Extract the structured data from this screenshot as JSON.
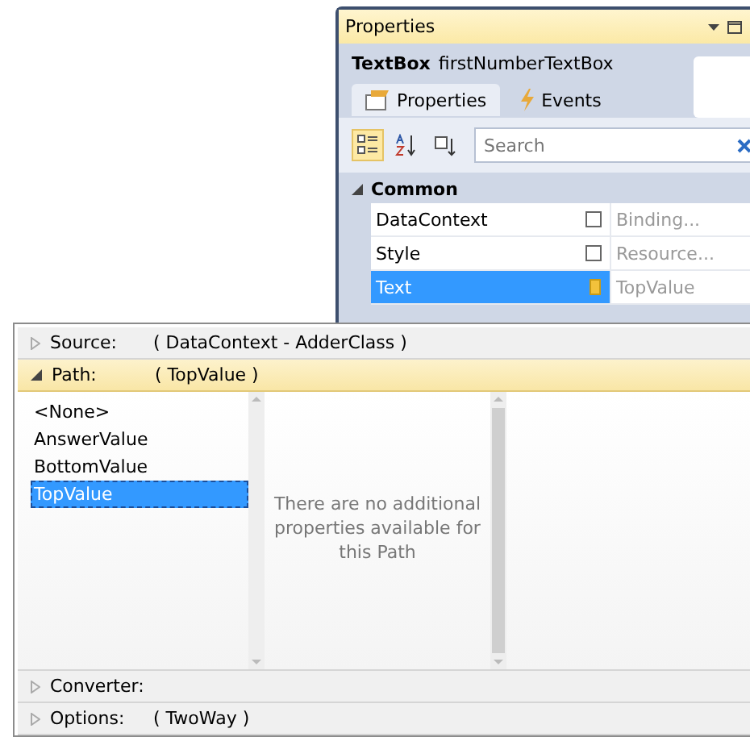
{
  "properties_panel": {
    "title": "Properties",
    "object": {
      "type": "TextBox",
      "name": "firstNumberTextBox"
    },
    "tabs": [
      {
        "label": "Properties",
        "kind": "properties",
        "selected": true
      },
      {
        "label": "Events",
        "kind": "events",
        "selected": false
      }
    ],
    "view_buttons": [
      {
        "kind": "categorized",
        "selected": true
      },
      {
        "kind": "alphabetical",
        "selected": false
      },
      {
        "kind": "filter",
        "selected": false
      }
    ],
    "search": {
      "placeholder": "Search"
    },
    "categories": [
      {
        "name": "Common",
        "expanded": true,
        "rows": [
          {
            "name": "DataContext",
            "value": "Binding...",
            "bound": false,
            "selected": false
          },
          {
            "name": "Style",
            "value": "Resource...",
            "bound": false,
            "selected": false
          },
          {
            "name": "Text",
            "value": "TopValue",
            "bound": true,
            "selected": true
          }
        ]
      }
    ]
  },
  "binding_editor": {
    "sections": [
      {
        "label": "Source:",
        "value": "( DataContext - AdderClass )",
        "expanded": false
      },
      {
        "label": "Path:",
        "value": "( TopValue )",
        "expanded": true,
        "items": [
          {
            "label": "<None>",
            "selected": false
          },
          {
            "label": "AnswerValue",
            "selected": false
          },
          {
            "label": "BottomValue",
            "selected": false
          },
          {
            "label": "TopValue",
            "selected": true
          }
        ],
        "message": "There are no additional properties available for this Path"
      },
      {
        "label": "Converter:",
        "expanded": false
      },
      {
        "label": "Options:",
        "value": "( TwoWay )",
        "expanded": false
      }
    ]
  }
}
